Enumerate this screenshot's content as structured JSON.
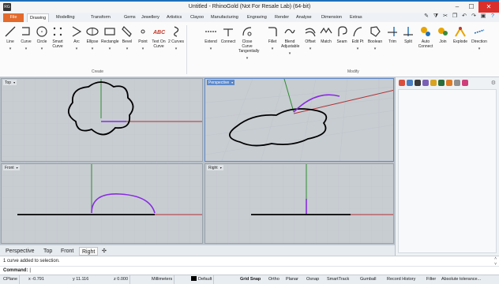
{
  "window": {
    "title": "Untitled - RhinoGold (Not For Resale Lab) (64-bit)",
    "app_icon_text": "RG",
    "controls": {
      "minimize": "–",
      "maximize": "☐",
      "close": "✕"
    }
  },
  "ribbon": {
    "tabs": [
      "File",
      "Drawing",
      "Modelling",
      "Transform",
      "Gems",
      "Jewellery",
      "Artistics",
      "Clayoo",
      "Manufacturing",
      "Engraving",
      "Render",
      "Analyse",
      "Dimension",
      "Extras"
    ],
    "active_tab": "Drawing",
    "create_label": "Create",
    "modify_label": "Modify",
    "create_buttons": [
      {
        "label": "Line",
        "icon": "line-icon"
      },
      {
        "label": "Curve",
        "icon": "curve-icon"
      },
      {
        "label": "Circle",
        "icon": "circle-icon"
      },
      {
        "label": "Smart Curve",
        "icon": "smart-curve-icon"
      },
      {
        "label": "Arc",
        "icon": "arc-icon"
      },
      {
        "label": "Ellipse",
        "icon": "ellipse-icon"
      },
      {
        "label": "Rectangle",
        "icon": "rectangle-icon"
      },
      {
        "label": "Bevel",
        "icon": "bevel-icon"
      },
      {
        "label": "Point",
        "icon": "point-icon"
      },
      {
        "label": "Text On Curve",
        "icon": "text-on-curve-icon",
        "glyph": "ABC"
      },
      {
        "label": "2 Curves",
        "icon": "two-curves-icon"
      }
    ],
    "modify_buttons": [
      {
        "label": "Extend",
        "icon": "extend-icon"
      },
      {
        "label": "Connect",
        "icon": "connect-icon"
      },
      {
        "label": "Close Curve Tangentially",
        "icon": "close-curve-icon"
      },
      {
        "label": "Fillet",
        "icon": "fillet-icon"
      },
      {
        "label": "Blend Adjustable",
        "icon": "blend-icon"
      },
      {
        "label": "Offset",
        "icon": "offset-icon"
      },
      {
        "label": "Match",
        "icon": "match-icon"
      },
      {
        "label": "Seam",
        "icon": "seam-icon"
      },
      {
        "label": "Edit Pt",
        "icon": "edit-point-icon"
      },
      {
        "label": "Boolean",
        "icon": "boolean-icon"
      },
      {
        "label": "Trim",
        "icon": "trim-icon"
      },
      {
        "label": "Split",
        "icon": "split-icon"
      },
      {
        "label": "Auto Connect",
        "icon": "auto-connect-icon"
      },
      {
        "label": "Join",
        "icon": "join-icon"
      },
      {
        "label": "Explode",
        "icon": "explode-icon"
      },
      {
        "label": "Direction",
        "icon": "direction-icon"
      }
    ],
    "quick_access": [
      "brush-icon",
      "filter-icon",
      "cut-icon",
      "copy-icon",
      "undo-icon",
      "redo-icon",
      "save-icon",
      "help-icon"
    ]
  },
  "viewports": {
    "top": {
      "label": "Top"
    },
    "perspective": {
      "label": "Perspective"
    },
    "front": {
      "label": "Front"
    },
    "right": {
      "label": "Right"
    }
  },
  "view_tabs": [
    "Perspective",
    "Top",
    "Front",
    "Right"
  ],
  "view_tabs_active": "Right",
  "view_tabs_add": "✣",
  "command": {
    "history": "1 curve added to selection.",
    "prompt": "Command:"
  },
  "status": {
    "cplane": "CPlane",
    "x": "x -0.791",
    "y": "y 11.116",
    "z": "z 0.000",
    "units": "Millimeters",
    "layer": "Default",
    "toggles": [
      "Grid Snap",
      "Ortho",
      "Planar",
      "Osnap",
      "SmartTrack",
      "Gumball",
      "Record History",
      "Filter"
    ],
    "grid_snap_on": true,
    "tolerance": "Absolute tolerance..."
  },
  "colors": {
    "accent": "#1f6fb8",
    "file_tab": "#e36a2b",
    "curve_selected": "#8a2be2",
    "x_axis": "#b03030",
    "y_axis": "#2e8b2e",
    "viewport_bg": "#c8cdd2"
  }
}
